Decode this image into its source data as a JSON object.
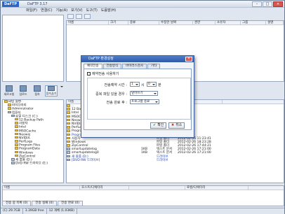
{
  "app": {
    "logo": "DaFTP",
    "title": "DaFTP 3.17"
  },
  "menu": [
    "파일(F)",
    "연결(C)",
    "기능(A)",
    "보기(V)",
    "도구(T)",
    "도움말(H)"
  ],
  "remote_headers": [
    "이름",
    "크기",
    "종류",
    "수정한 날짜",
    "권한",
    "소유자",
    "그룹",
    "설명"
  ],
  "left_toolbar": [
    "새로고침",
    "업로드",
    "접속",
    "접속끊기"
  ],
  "tree": [
    {
      "label": "바탕 화면",
      "kind": "desk",
      "indent": 0
    },
    {
      "label": "라이브러리",
      "kind": "fold",
      "indent": 1
    },
    {
      "label": "Administrator",
      "kind": "fold",
      "indent": 1
    },
    {
      "label": "컴퓨터",
      "kind": "drv",
      "indent": 1
    },
    {
      "label": "로컬 디스크 (C:)",
      "kind": "drv",
      "indent": 2
    },
    {
      "label": "12 Backup Path",
      "kind": "fold",
      "indent": 3
    },
    {
      "label": "사용자",
      "kind": "fold",
      "indent": 3
    },
    {
      "label": "Intel",
      "kind": "fold",
      "indent": 3
    },
    {
      "label": "MSOCache",
      "kind": "fold",
      "indent": 3
    },
    {
      "label": "Neowiz",
      "kind": "fold",
      "indent": 3
    },
    {
      "label": "NVIDIA",
      "kind": "fold",
      "indent": 3
    },
    {
      "label": "PerfLogs",
      "kind": "fold",
      "indent": 3
    },
    {
      "label": "Program Files",
      "kind": "fold",
      "indent": 3
    },
    {
      "label": "ProgramData",
      "kind": "fold",
      "indent": 3
    },
    {
      "label": "Windows",
      "kind": "fold",
      "indent": 3
    },
    {
      "label": "ZipControl",
      "kind": "fold",
      "indent": 3
    },
    {
      "label": "새 볼륨 (D:)",
      "kind": "drv",
      "indent": 2
    },
    {
      "label": "DVD RW 드라이브 (E:)",
      "kind": "drv",
      "indent": 2
    }
  ],
  "local_headers": [
    "이름",
    "크기",
    "종류",
    "수정한 날짜"
  ],
  "files": [
    {
      "name": "..",
      "size": "",
      "type": "",
      "date": "",
      "blue": false
    },
    {
      "name": "12 Backup Path",
      "size": "",
      "type": "",
      "date": "",
      "blue": false
    },
    {
      "name": "Intel",
      "size": "",
      "type": "",
      "date": "",
      "blue": false
    },
    {
      "name": "MSOCache",
      "size": "",
      "type": "",
      "date": "",
      "blue": false
    },
    {
      "name": "Neowiz",
      "size": "",
      "type": "",
      "date": "",
      "blue": false
    },
    {
      "name": "NVIDIA",
      "size": "",
      "type": "",
      "date": "",
      "blue": false
    },
    {
      "name": "PerfLogs",
      "size": "",
      "type": "",
      "date": "",
      "blue": false
    },
    {
      "name": "Program Files",
      "size": "",
      "type": "",
      "date": "",
      "blue": false
    },
    {
      "name": "ProgramData",
      "size": "",
      "type": "",
      "date": "",
      "blue": true
    },
    {
      "name": "사용자",
      "size": "",
      "type": "파일 폴더",
      "date": "2012-02-06 11:23:41",
      "blue": false
    },
    {
      "name": "Windows",
      "size": "",
      "type": "파일 폴더",
      "date": "2012-02-26 18:23:28",
      "blue": false
    },
    {
      "name": "ZipControl",
      "size": "",
      "type": "파일 폴더",
      "date": "2012-02-26 17:44:21",
      "blue": false
    },
    {
      "name": "smartupdatelog",
      "size": "1KB",
      "type": "텍스트 문서",
      "date": "2012-02-26 17:21:00",
      "blue": false
    },
    {
      "name": "smartupdatelog0",
      "size": "1KB",
      "type": "텍스트 문서",
      "date": "2012-02-26 17:21:00",
      "blue": false
    },
    {
      "name": "새 볼륨 (D:)",
      "size": "",
      "type": "드라이브",
      "date": "",
      "blue": true
    },
    {
      "name": "[DVD RW 드라이브]",
      "size": "",
      "type": "드라이브",
      "date": "",
      "blue": true
    }
  ],
  "queue_headers": [
    "이름",
    "호스트/디렉터리",
    "",
    "로컬/디렉터리"
  ],
  "queue_tabs": [
    "전송 중 목록 (0)",
    "전송 실패 (0)",
    "전송 완료 (0)"
  ],
  "status": [
    "(C) 29.7GB",
    "3.39GB free",
    "12 개체 (1.03KB)"
  ],
  "dialog": {
    "title": "DaFTP 환경설정",
    "tabs": [
      "예약전송",
      "전송방식",
      "바이러스검사",
      "기타"
    ],
    "checkbox": "예약전송 사용하기",
    "time_label": "전송예약 시간 :",
    "hour": "1",
    "hour_unit": "시",
    "minute": "0",
    "minute_unit": "분",
    "dup_label": "중복 파일 있을 경우 :",
    "dup_value": "덮어쓰기",
    "after_label": "전송 완료 후 :",
    "after_value": "프로그램 종료",
    "ok": "확인",
    "cancel": "취소"
  },
  "colors": {
    "accent": "#2e5aa6",
    "folder": "#e9c04a"
  }
}
